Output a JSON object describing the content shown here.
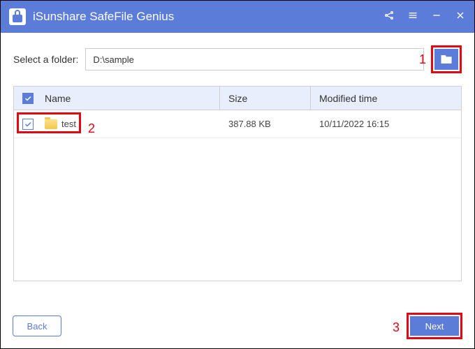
{
  "app": {
    "title": "iSunshare SafeFile Genius"
  },
  "folder": {
    "label": "Select a folder:",
    "path": "D:\\sample"
  },
  "columns": {
    "name": "Name",
    "size": "Size",
    "time": "Modified time"
  },
  "rows": [
    {
      "checked": true,
      "name": "test",
      "size": "387.88 KB",
      "time": "10/11/2022 16:15"
    }
  ],
  "buttons": {
    "back": "Back",
    "next": "Next"
  },
  "annotations": {
    "a1": "1",
    "a2": "2",
    "a3": "3"
  }
}
